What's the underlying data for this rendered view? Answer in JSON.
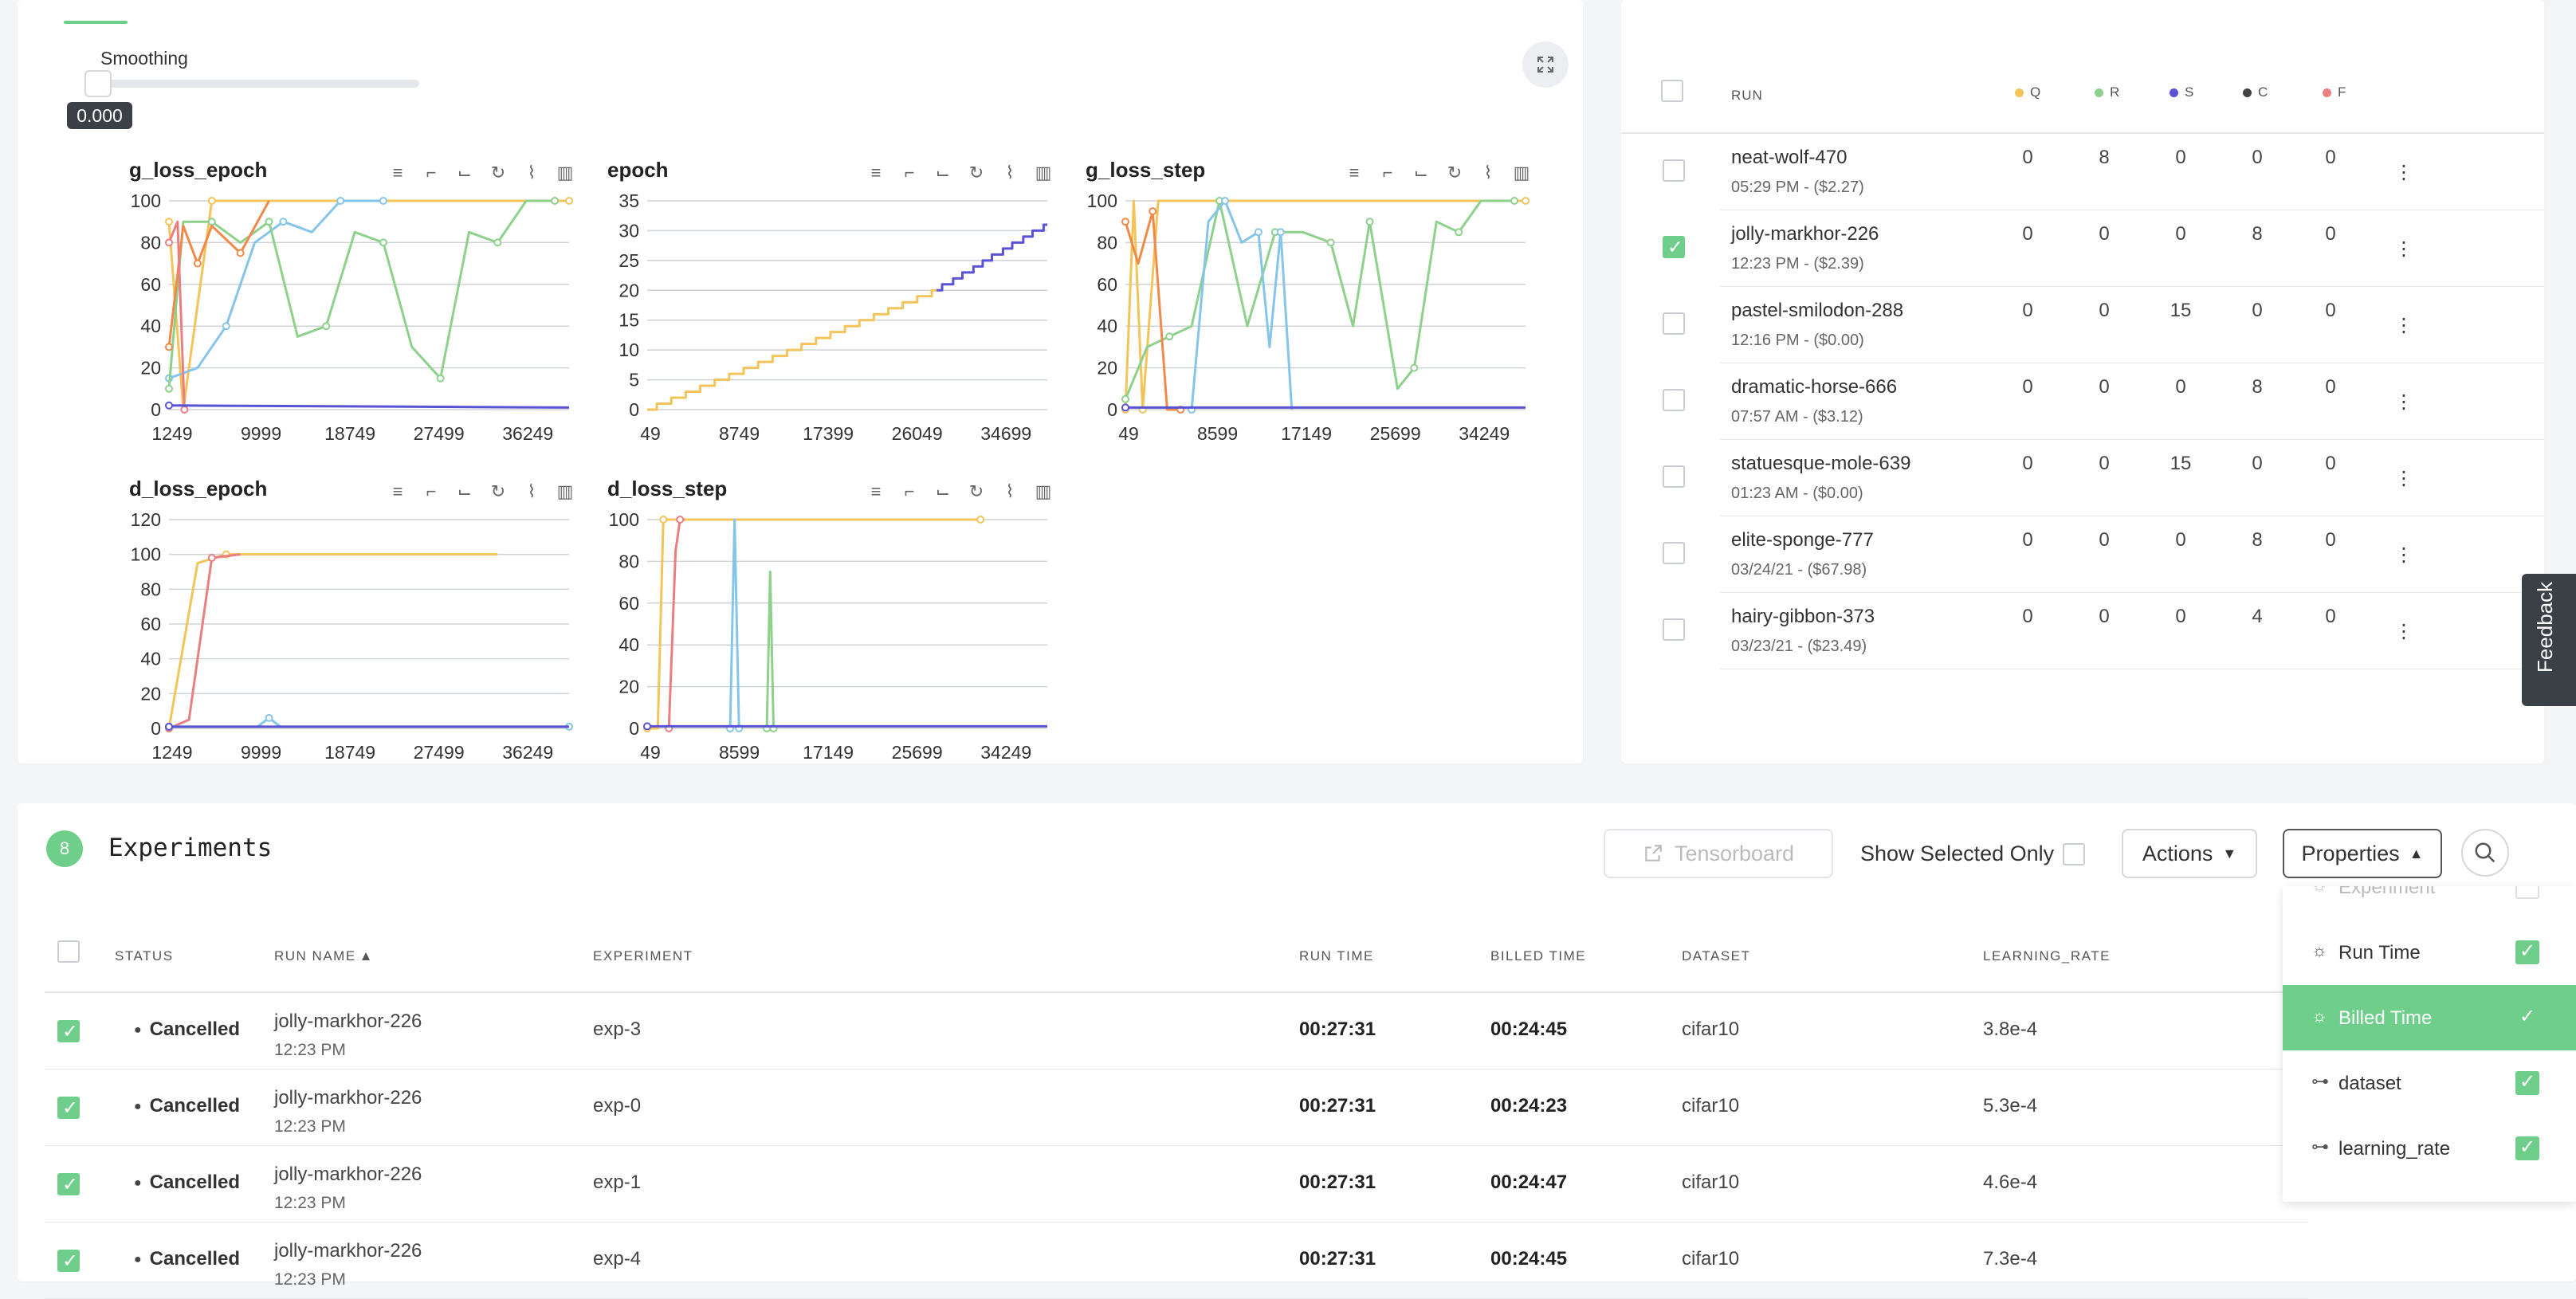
{
  "charts_panel": {
    "smoothing_label": "Smoothing",
    "smoothing_value": "0.000",
    "smoothing_level": 0.0,
    "expand_icon": "expand-icon",
    "tool_icons": [
      "menu-icon",
      "crop-icon",
      "crop-alt-icon",
      "refresh-icon",
      "line-chart-icon",
      "bar-chart-icon"
    ]
  },
  "chart_data": [
    {
      "type": "line",
      "title": "g_loss_epoch",
      "ylim": [
        0,
        100
      ],
      "yticks": [
        "100",
        "80",
        "60",
        "40",
        "20",
        "0"
      ],
      "xticks": [
        "1249",
        "9999",
        "18749",
        "27499",
        "36249"
      ],
      "series": [
        {
          "color": "#f2c45a",
          "x": [
            1249,
            2500,
            5000,
            8750,
            36249
          ],
          "values": [
            90,
            0,
            100,
            100,
            100
          ]
        },
        {
          "color": "#86c5ea",
          "x": [
            1249,
            3750,
            6250,
            8750,
            11250,
            13750,
            16250,
            18750,
            20000
          ],
          "values": [
            15,
            20,
            40,
            80,
            90,
            85,
            100,
            100,
            100
          ]
        },
        {
          "color": "#8dd18c",
          "x": [
            1249,
            2500,
            5000,
            7500,
            10000,
            12500,
            15000,
            17500,
            20000,
            22500,
            25000,
            27500,
            30000,
            32500,
            35000
          ],
          "values": [
            10,
            90,
            90,
            80,
            90,
            35,
            40,
            85,
            80,
            30,
            15,
            85,
            80,
            100,
            100
          ]
        },
        {
          "color": "#f08a4b",
          "x": [
            1249,
            2500,
            3750,
            5000,
            7500,
            10000
          ],
          "values": [
            30,
            88,
            70,
            88,
            75,
            100
          ]
        },
        {
          "color": "#e97f80",
          "x": [
            1249,
            2000,
            2600
          ],
          "values": [
            80,
            90,
            0
          ]
        },
        {
          "color": "#5a52d5",
          "x": [
            1249,
            36249
          ],
          "values": [
            2,
            1
          ]
        }
      ]
    },
    {
      "type": "line",
      "title": "epoch",
      "ylim": [
        0,
        35
      ],
      "yticks": [
        "35",
        "30",
        "25",
        "20",
        "15",
        "10",
        "5",
        "0"
      ],
      "xticks": [
        "49",
        "8749",
        "17399",
        "26049",
        "34699"
      ],
      "series": [
        {
          "color": "#f2c45a",
          "x": [
            49,
            26049
          ],
          "values": [
            0,
            20
          ]
        },
        {
          "color": "#5a52d5",
          "x": [
            26049,
            36000
          ],
          "values": [
            20,
            31
          ]
        }
      ]
    },
    {
      "type": "line",
      "title": "g_loss_step",
      "ylim": [
        0,
        100
      ],
      "yticks": [
        "100",
        "80",
        "60",
        "40",
        "20",
        "0"
      ],
      "xticks": [
        "49",
        "8599",
        "17149",
        "25699",
        "34249"
      ],
      "series": [
        {
          "color": "#f2c45a",
          "x": [
            49,
            800,
            1600,
            3000,
            36000
          ],
          "values": [
            0,
            100,
            0,
            100,
            100
          ]
        },
        {
          "color": "#8dd18c",
          "x": [
            49,
            2000,
            4000,
            6000,
            8500,
            11000,
            13500,
            16000,
            18500,
            20500,
            22000,
            24500,
            26000,
            28000,
            30000,
            32000,
            35000
          ],
          "values": [
            5,
            30,
            35,
            40,
            100,
            40,
            85,
            85,
            80,
            40,
            90,
            10,
            20,
            90,
            85,
            100,
            100
          ]
        },
        {
          "color": "#86c5ea",
          "x": [
            6000,
            7500,
            9000,
            10500,
            12000,
            13000,
            14000,
            15000
          ],
          "values": [
            0,
            90,
            100,
            80,
            85,
            30,
            85,
            0
          ]
        },
        {
          "color": "#f08a4b",
          "x": [
            49,
            1200,
            2500,
            3800,
            5000
          ],
          "values": [
            90,
            70,
            95,
            0,
            0
          ]
        },
        {
          "color": "#5a52d5",
          "x": [
            49,
            36000
          ],
          "values": [
            1,
            1
          ]
        }
      ]
    },
    {
      "type": "line",
      "title": "d_loss_epoch",
      "ylim": [
        0,
        120
      ],
      "yticks": [
        "120",
        "100",
        "80",
        "60",
        "40",
        "20",
        "0"
      ],
      "xticks": [
        "1249",
        "9999",
        "18749",
        "27499",
        "36249"
      ],
      "series": [
        {
          "color": "#f2c45a",
          "x": [
            1249,
            3750,
            6250,
            30000
          ],
          "values": [
            0,
            95,
            100,
            100
          ]
        },
        {
          "color": "#e97f80",
          "x": [
            1249,
            3000,
            5000,
            7500
          ],
          "values": [
            0,
            5,
            98,
            100
          ]
        },
        {
          "color": "#86c5ea",
          "x": [
            1249,
            9000,
            10000,
            11000,
            36249
          ],
          "values": [
            1,
            1,
            6,
            1,
            1
          ]
        },
        {
          "color": "#5a52d5",
          "x": [
            1249,
            36249
          ],
          "values": [
            1,
            1
          ]
        }
      ]
    },
    {
      "type": "line",
      "title": "d_loss_step",
      "ylim": [
        0,
        100
      ],
      "yticks": [
        "100",
        "80",
        "60",
        "40",
        "20",
        "0"
      ],
      "xticks": [
        "49",
        "8599",
        "17149",
        "25699",
        "34249"
      ],
      "series": [
        {
          "color": "#f2c45a",
          "x": [
            49,
            1000,
            1500,
            2000,
            30000
          ],
          "values": [
            0,
            0,
            100,
            100,
            100
          ]
        },
        {
          "color": "#e97f80",
          "x": [
            2000,
            2600,
            3000,
            3400
          ],
          "values": [
            0,
            85,
            100,
            100
          ]
        },
        {
          "color": "#86c5ea",
          "x": [
            7500,
            7900,
            8300
          ],
          "values": [
            0,
            100,
            0
          ]
        },
        {
          "color": "#8dd18c",
          "x": [
            10800,
            11100,
            11400
          ],
          "values": [
            0,
            75,
            0
          ]
        },
        {
          "color": "#5a52d5",
          "x": [
            49,
            36000
          ],
          "values": [
            1,
            1
          ]
        }
      ]
    }
  ],
  "runs_panel": {
    "col_run": "RUN",
    "legend": [
      {
        "label": "Q",
        "color": "#f2c45a"
      },
      {
        "label": "R",
        "color": "#8dd18c"
      },
      {
        "label": "S",
        "color": "#5a52d5"
      },
      {
        "label": "C",
        "color": "#444444"
      },
      {
        "label": "F",
        "color": "#e97f80"
      }
    ],
    "rows": [
      {
        "name": "neat-wolf-470",
        "sub": "05:29 PM - ($2.27)",
        "checked": false,
        "vals": [
          "0",
          "8",
          "0",
          "0",
          "0"
        ]
      },
      {
        "name": "jolly-markhor-226",
        "sub": "12:23 PM - ($2.39)",
        "checked": true,
        "vals": [
          "0",
          "0",
          "0",
          "8",
          "0"
        ]
      },
      {
        "name": "pastel-smilodon-288",
        "sub": "12:16 PM - ($0.00)",
        "checked": false,
        "vals": [
          "0",
          "0",
          "15",
          "0",
          "0"
        ]
      },
      {
        "name": "dramatic-horse-666",
        "sub": "07:57 AM - ($3.12)",
        "checked": false,
        "vals": [
          "0",
          "0",
          "0",
          "8",
          "0"
        ]
      },
      {
        "name": "statuesque-mole-639",
        "sub": "01:23 AM - ($0.00)",
        "checked": false,
        "vals": [
          "0",
          "0",
          "15",
          "0",
          "0"
        ]
      },
      {
        "name": "elite-sponge-777",
        "sub": "03/24/21 - ($67.98)",
        "checked": false,
        "vals": [
          "0",
          "0",
          "0",
          "8",
          "0"
        ]
      },
      {
        "name": "hairy-gibbon-373",
        "sub": "03/23/21 - ($23.49)",
        "checked": false,
        "vals": [
          "0",
          "0",
          "0",
          "4",
          "0"
        ]
      }
    ]
  },
  "feedback_label": "Feedback",
  "experiments": {
    "count": "8",
    "title": "Experiments",
    "tensorboard_label": "Tensorboard",
    "show_selected_label": "Show Selected Only",
    "actions_label": "Actions",
    "properties_label": "Properties",
    "columns": {
      "status": "STATUS",
      "run_name": "RUN NAME",
      "experiment": "EXPERIMENT",
      "run_time": "RUN TIME",
      "billed_time": "BILLED TIME",
      "dataset": "DATASET",
      "learning_rate": "LEARNING_RATE"
    },
    "rows": [
      {
        "status": "Cancelled",
        "run_name": "jolly-markhor-226",
        "run_sub": "12:23 PM",
        "experiment": "exp-3",
        "run_time": "00:27:31",
        "billed_time": "00:24:45",
        "dataset": "cifar10",
        "learning_rate": "3.8e-4"
      },
      {
        "status": "Cancelled",
        "run_name": "jolly-markhor-226",
        "run_sub": "12:23 PM",
        "experiment": "exp-0",
        "run_time": "00:27:31",
        "billed_time": "00:24:23",
        "dataset": "cifar10",
        "learning_rate": "5.3e-4"
      },
      {
        "status": "Cancelled",
        "run_name": "jolly-markhor-226",
        "run_sub": "12:23 PM",
        "experiment": "exp-1",
        "run_time": "00:27:31",
        "billed_time": "00:24:47",
        "dataset": "cifar10",
        "learning_rate": "4.6e-4"
      },
      {
        "status": "Cancelled",
        "run_name": "jolly-markhor-226",
        "run_sub": "12:23 PM",
        "experiment": "exp-4",
        "run_time": "00:27:31",
        "billed_time": "00:24:45",
        "dataset": "cifar10",
        "learning_rate": "7.3e-4"
      }
    ]
  },
  "properties_menu": {
    "items": [
      {
        "label": "Experiment",
        "state": "disabled"
      },
      {
        "label": "Run Time",
        "state": "checked"
      },
      {
        "label": "Billed Time",
        "state": "selected"
      },
      {
        "label": "dataset",
        "state": "checked"
      },
      {
        "label": "learning_rate",
        "state": "checked"
      }
    ]
  }
}
